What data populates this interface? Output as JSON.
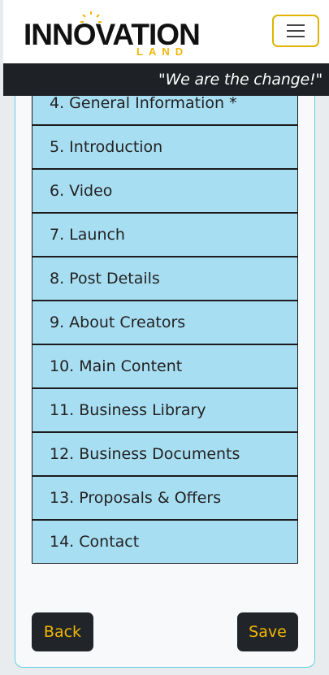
{
  "brand": {
    "logo_main": "INNOVATION",
    "logo_sub": "LAND",
    "tagline": "\"We are the change!\""
  },
  "header": {
    "menu_icon": "hamburger-icon"
  },
  "steps": [
    {
      "label": "4. General Information *"
    },
    {
      "label": "5. Introduction"
    },
    {
      "label": "6. Video"
    },
    {
      "label": "7. Launch"
    },
    {
      "label": "8. Post Details"
    },
    {
      "label": "9. About Creators"
    },
    {
      "label": "10. Main Content"
    },
    {
      "label": "11. Business Library"
    },
    {
      "label": "12. Business Documents"
    },
    {
      "label": "13. Proposals & Offers"
    },
    {
      "label": "14. Contact"
    }
  ],
  "actions": {
    "back_label": "Back",
    "save_label": "Save"
  },
  "colors": {
    "accent": "#f2b705",
    "step_bg": "#a8def2",
    "dark": "#212529"
  }
}
